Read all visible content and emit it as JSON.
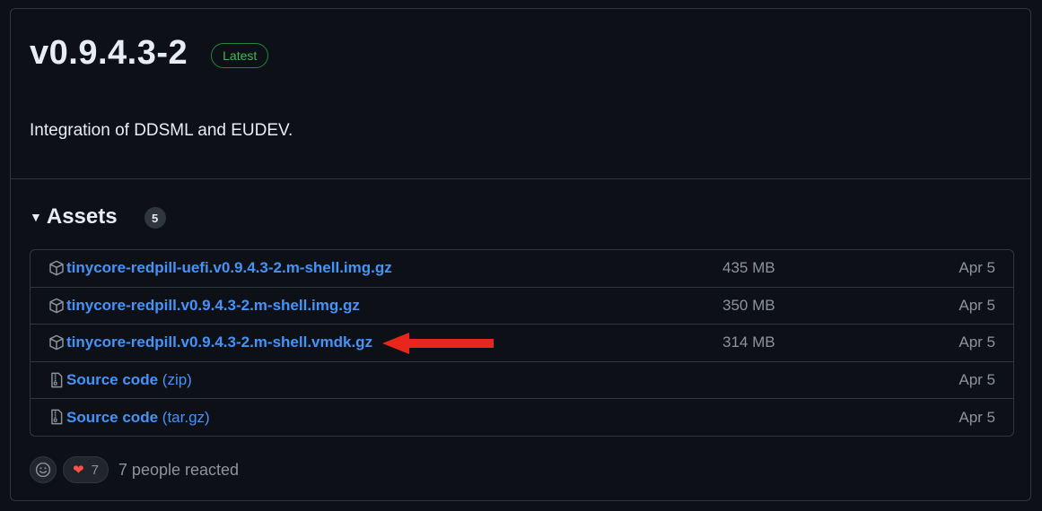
{
  "release": {
    "title": "v0.9.4.3-2",
    "badge": "Latest",
    "description": "Integration of DDSML and EUDEV."
  },
  "assets": {
    "label": "Assets",
    "count": "5",
    "items": [
      {
        "name": "tinycore-redpill-uefi.v0.9.4.3-2.m-shell.img.gz",
        "suffix": "",
        "size": "435 MB",
        "date": "Apr 5",
        "icon": "package-icon"
      },
      {
        "name": "tinycore-redpill.v0.9.4.3-2.m-shell.img.gz",
        "suffix": "",
        "size": "350 MB",
        "date": "Apr 5",
        "icon": "package-icon"
      },
      {
        "name": "tinycore-redpill.v0.9.4.3-2.m-shell.vmdk.gz",
        "suffix": "",
        "size": "314 MB",
        "date": "Apr 5",
        "icon": "package-icon"
      },
      {
        "name": "Source code",
        "suffix": "(zip)",
        "size": "",
        "date": "Apr 5",
        "icon": "file-zip-icon"
      },
      {
        "name": "Source code",
        "suffix": "(tar.gz)",
        "size": "",
        "date": "Apr 5",
        "icon": "file-zip-icon"
      }
    ]
  },
  "annotation": {
    "icon": "red-arrow-icon",
    "color": "#e8261c"
  },
  "reactions": {
    "heart_emoji": "❤",
    "heart_count": "7",
    "summary": "7 people reacted"
  },
  "colors": {
    "link": "#4493f8",
    "latest": "#3fb950",
    "background": "#0d1117",
    "border": "#30363d"
  }
}
